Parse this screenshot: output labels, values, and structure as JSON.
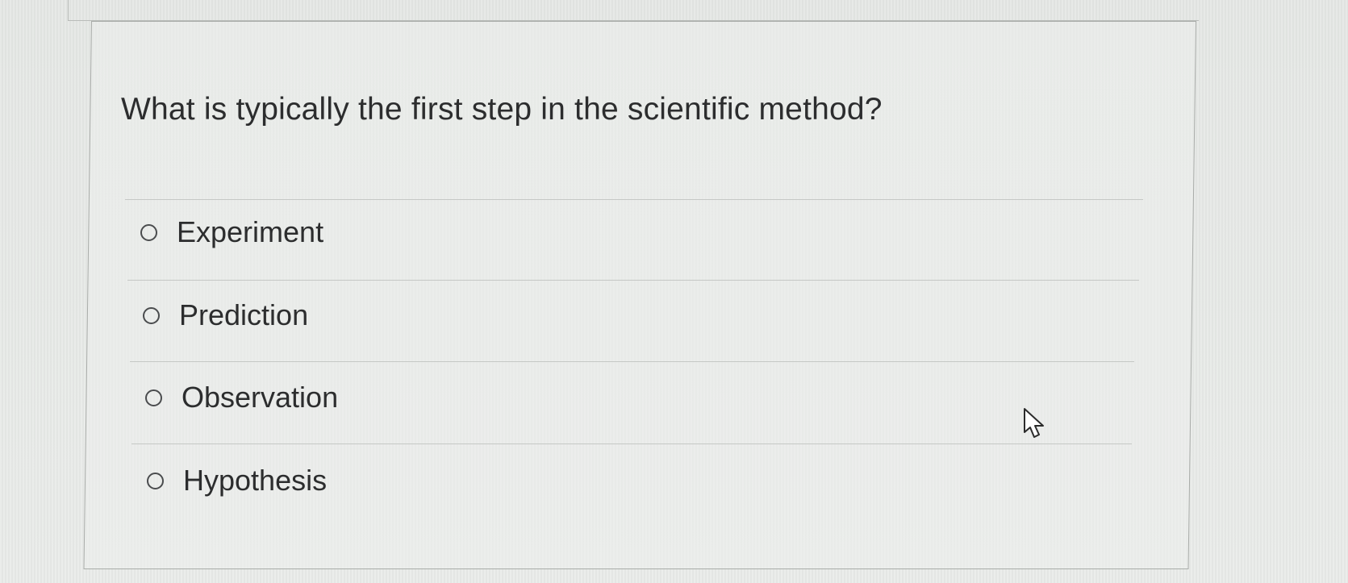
{
  "quiz": {
    "question": "What is typically the first step in the scientific method?",
    "options": [
      {
        "label": "Experiment",
        "selected": false
      },
      {
        "label": "Prediction",
        "selected": false
      },
      {
        "label": "Observation",
        "selected": false
      },
      {
        "label": "Hypothesis",
        "selected": false
      }
    ]
  },
  "icons": {
    "radio": "radio-button-unselected",
    "cursor": "mouse-pointer-arrow"
  },
  "colors": {
    "background": "#e6e8e6",
    "text": "#2c2d2e",
    "border": "#a9aca9",
    "divider": "#c5c8c5"
  }
}
